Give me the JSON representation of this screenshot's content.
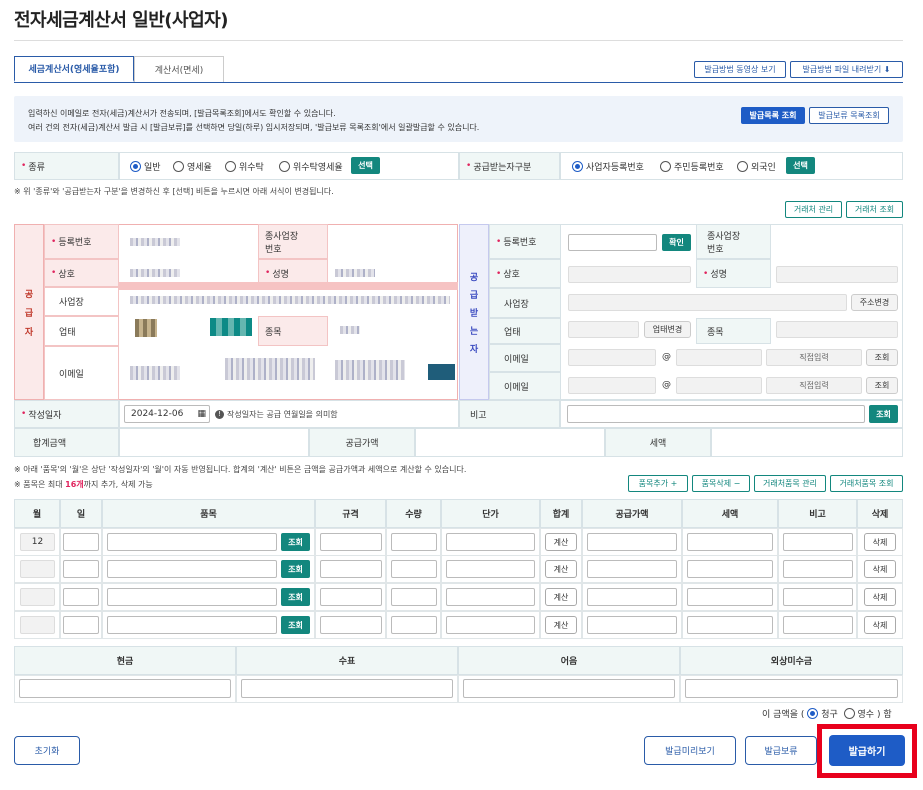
{
  "title": "전자세금계산서 일반(사업자)",
  "tabs": [
    "세금계산서(영세율포함)",
    "계산서(면세)"
  ],
  "top_buttons": {
    "video": "발급방법 동영상 보기",
    "download": "발급방법 파일 내려받기"
  },
  "notice": {
    "line1": "입력하신 이메일로 전자(세금)계산서가 전송되며, [발급목록조회]에서도 확인할 수 있습니다.",
    "line2": "여러 건의 전자(세금)계산서 발급 시 [발급보류]를 선택하면 당일(하루) 임시저장되며, '발급보류 목록조회'에서 일괄발급할 수 있습니다.",
    "btn_list": "발급목록 조회",
    "btn_hold": "발급보류 목록조회"
  },
  "type_row": {
    "label": "종류",
    "options": [
      "일반",
      "영세율",
      "위수탁",
      "위수탁영세율"
    ],
    "selected": 0,
    "select_btn": "선택",
    "buyer_label": "공급받는자구분",
    "buyer_options": [
      "사업자등록번호",
      "주민등록번호",
      "외국인"
    ],
    "buyer_selected": 0
  },
  "type_note": "※ 위 '종류'와 '공급받는자 구분'을 변경하신 후 [선택] 비튼을 누르시면 아래 서식이 변경됩니다.",
  "partner_buttons": {
    "manage": "거래처 관리",
    "search": "거래처 조회"
  },
  "supplier": {
    "side": [
      "공",
      "급",
      "자"
    ],
    "reg_no": "등록번호",
    "sub_biz": "종사업장",
    "sub_biz2": "번호",
    "name": "상호",
    "rep": "성명",
    "addr": "사업장",
    "biz_type": "업태",
    "item": "종목",
    "email": "이메일"
  },
  "buyer": {
    "side": [
      "공",
      "급",
      "받",
      "는",
      "자"
    ],
    "reg_no": "등록번호",
    "confirm": "확인",
    "sub_biz": "종사업장",
    "sub_biz2": "번호",
    "name": "상호",
    "rep": "성명",
    "addr": "사업장",
    "addr_btn": "주소변경",
    "biz_type": "업태",
    "biz_change": "업태변경",
    "item": "종목",
    "email1": "이메일",
    "email2": "이메일",
    "at": "@",
    "direct": "직접입력",
    "search": "조회"
  },
  "date_row": {
    "label": "작성일자",
    "value": "2024-12-06",
    "hint": "작성일자는 공급 연월일을 의미함",
    "note_label": "비고",
    "search": "조회"
  },
  "sum_row": {
    "total": "합계금액",
    "supply": "공급가액",
    "tax": "세액"
  },
  "notes": {
    "n1": "※ 아래 '품목'의 '월'은 상단 '작성일자'의 '월'이 자동 반영됩니다. 합계의 '계산' 비튼은 금액을 공급가액과 세액으로 계산할 수 있습니다.",
    "n2a": "※ 품목은 최대 ",
    "n2b": "16개",
    "n2c": "까지 추가, 삭제 가능"
  },
  "item_buttons": {
    "add": "품목추가 +",
    "del": "품목삭제 −",
    "manage": "거래처품목 관리",
    "search": "거래처품목 조회"
  },
  "item_headers": [
    "월",
    "일",
    "품목",
    "규격",
    "수량",
    "단가",
    "합계",
    "공급가액",
    "세액",
    "비고",
    "삭제"
  ],
  "item_row": {
    "month": "12",
    "search": "조회",
    "calc": "계산",
    "delete": "삭제"
  },
  "pay_headers": [
    "현금",
    "수표",
    "어음",
    "외상미수금"
  ],
  "amount": {
    "prefix": "이 금액을 (",
    "opt1": "청구",
    "opt2": "영수",
    "suffix": ") 함"
  },
  "bottom": {
    "reset": "초기화",
    "preview": "발급미리보기",
    "hold": "발급보류",
    "issue": "발급하기"
  },
  "colors": {
    "primary": "#1e5cc6",
    "teal": "#13877e",
    "highlight": "#e8001c"
  }
}
